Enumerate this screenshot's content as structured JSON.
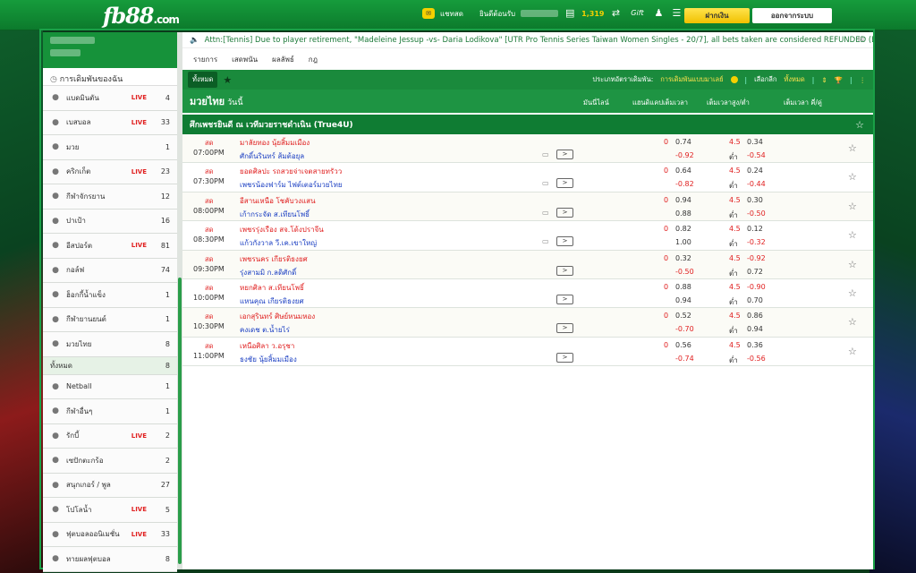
{
  "header": {
    "logo": "fb88",
    "logo_suffix": ".com",
    "chat_label": "แชทสด",
    "welcome": "ยินดีต้อนรับ",
    "credit": "1,319",
    "deposit_label": "ฝากเงิน",
    "logout_label": "ออกจากระบบ",
    "icons": [
      "chat-icon",
      "wallet-icon",
      "refresh-icon",
      "promo-icon",
      "user-icon",
      "list-icon",
      "settings-icon"
    ]
  },
  "ticker": {
    "text": "Attn:[Tennis] Due to player retirement, \"Madeleine Jessup -vs- Daria Lodikova\" [UTR Pro Tennis Series Taiwan Women Singles - 20/7], all bets taken are considered REFUNDED (Except"
  },
  "tabs": [
    "รายการ",
    "เสดพนัน",
    "ผลลัพธ์",
    "กฎ"
  ],
  "sidebar": {
    "header": "การเดิมพันของฉัน",
    "items": [
      {
        "label": "แบดมินตัน",
        "live": "LIVE",
        "count": "4",
        "icon": "badminton-icon"
      },
      {
        "label": "เบสบอล",
        "live": "LIVE",
        "count": "33",
        "icon": "baseball-icon"
      },
      {
        "label": "มวย",
        "live": "",
        "count": "1",
        "icon": "boxing-icon"
      },
      {
        "label": "คริกเก็ต",
        "live": "LIVE",
        "count": "23",
        "icon": "cricket-icon"
      },
      {
        "label": "กีฬาจักรยาน",
        "live": "",
        "count": "12",
        "icon": "cycling-icon"
      },
      {
        "label": "ปาเป้า",
        "live": "",
        "count": "16",
        "icon": "darts-icon"
      },
      {
        "label": "อีสปอร์ต",
        "live": "LIVE",
        "count": "81",
        "icon": "esports-icon"
      },
      {
        "label": "กอล์ฟ",
        "live": "",
        "count": "74",
        "icon": "golf-icon"
      },
      {
        "label": "ฮ็อกกี้น้ำแข็ง",
        "live": "",
        "count": "1",
        "icon": "hockey-icon"
      },
      {
        "label": "กีฬายานยนต์",
        "live": "",
        "count": "1",
        "icon": "motorsport-icon"
      },
      {
        "label": "มวยไทย",
        "live": "",
        "count": "8",
        "icon": "muaythai-icon"
      }
    ],
    "sub_item": {
      "label": "ทั้งหมด",
      "count": "8"
    },
    "items2": [
      {
        "label": "Netball",
        "live": "",
        "count": "1",
        "icon": "netball-icon"
      },
      {
        "label": "กีฬาอื่นๆ",
        "live": "",
        "count": "1",
        "icon": "other-sports-icon"
      },
      {
        "label": "รักบี้",
        "live": "LIVE",
        "count": "2",
        "icon": "rugby-icon"
      },
      {
        "label": "เซปักตะกร้อ",
        "live": "",
        "count": "2",
        "icon": "sepaktakraw-icon"
      },
      {
        "label": "สนุกเกอร์ / พูล",
        "live": "",
        "count": "27",
        "icon": "snooker-icon"
      },
      {
        "label": "โปโลน้ำ",
        "live": "LIVE",
        "count": "5",
        "icon": "waterpolo-icon"
      },
      {
        "label": "ฟุตบอลออนิเมชั่น",
        "live": "LIVE",
        "count": "33",
        "icon": "virtual-football-icon"
      },
      {
        "label": "ทายผลฟุตบอล",
        "live": "",
        "count": "8",
        "icon": "football-predict-icon"
      }
    ]
  },
  "filter": {
    "all_label": "ทั้งหมด",
    "bet_type_label": "ประเภทอัตราเดิมพัน:",
    "bet_type_value": "การเดิมพันแบบมาเลย์",
    "select_label": "เลือกลีก",
    "select_value": "ทั้งหมด"
  },
  "columns": {
    "sport": "มวยไทย",
    "today": "วันนี้",
    "c1": "มันนี่ไลน์",
    "c2": "แฮนดิแคปเต็มเวลา",
    "c3": "เต็มเวลาสูง/ต่ำ",
    "c4": "เต็มเวลา คี่/คู่"
  },
  "league": "ศึกเพชรยินดี ณ เวทีมวยราชดำเนิน (True4U)",
  "matches": [
    {
      "status": "สด",
      "time": "07:00PM",
      "home": "มาลัยทอง นุ้ยสิ้มมเมือง",
      "away": "ศักดิ์นรินทร์ ส้มต้อยุล",
      "hdp": "0",
      "ho": "0.74",
      "ao": "-0.92",
      "ou": "4.5",
      "oo": "0.34",
      "ul": "ต่ำ",
      "uo": "-0.54",
      "chat": true
    },
    {
      "status": "สด",
      "time": "07:30PM",
      "home": "ยอดศิลปะ รถสวยจ่าเจตสายทรัวว",
      "away": "เพชรน้องฟาร์ม ไฟต์เตอร์มวยไทย",
      "hdp": "0",
      "ho": "0.64",
      "ao": "-0.82",
      "ou": "4.5",
      "oo": "0.24",
      "ul": "ต่ำ",
      "uo": "-0.44",
      "chat": true
    },
    {
      "status": "สด",
      "time": "08:00PM",
      "home": "อีสานเหนือ โชคับวงแสน",
      "away": "เก้ากระจัด ส.เทียนโพธิ์",
      "hdp": "0",
      "ho": "0.94",
      "ao": "0.88",
      "ou": "4.5",
      "oo": "0.30",
      "ul": "ต่ำ",
      "uo": "-0.50",
      "chat": true
    },
    {
      "status": "สด",
      "time": "08:30PM",
      "home": "เพชรรุ่งเรือง สจ.โด้งปราจีน",
      "away": "แก้วกังวาล วี.เค.เขาใหญ่",
      "hdp": "0",
      "ho": "0.82",
      "ao": "1.00",
      "ou": "4.5",
      "oo": "0.12",
      "ul": "ต่ำ",
      "uo": "-0.32",
      "chat": true
    },
    {
      "status": "สด",
      "time": "09:30PM",
      "home": "เพชรนคร เกียรติธงยศ",
      "away": "รุ่งสามมิ ก.ลดิศักดิ์",
      "hdp": "0",
      "ho": "0.32",
      "ao": "-0.50",
      "ou": "4.5",
      "oo": "-0.92",
      "ul": "ต่ำ",
      "uo": "0.72",
      "chat": false
    },
    {
      "status": "สด",
      "time": "10:00PM",
      "home": "หยกศิลา ส.เทียนโพธิ์",
      "away": "แหนคุณ เกียรติธงยศ",
      "hdp": "0",
      "ho": "0.88",
      "ao": "0.94",
      "ou": "4.5",
      "oo": "-0.90",
      "ul": "ต่ำ",
      "uo": "0.70",
      "chat": false
    },
    {
      "status": "สด",
      "time": "10:30PM",
      "home": "เอกสุรินทร์ ศิษย์หนมหอง",
      "away": "คงเดช ต.น้ำยไร่",
      "hdp": "0",
      "ho": "0.52",
      "ao": "-0.70",
      "ou": "4.5",
      "oo": "0.86",
      "ul": "ต่ำ",
      "uo": "0.94",
      "chat": false
    },
    {
      "status": "สด",
      "time": "11:00PM",
      "home": "เหนือศิลา ว.อรุชา",
      "away": "ธงชัย นุ้ยสิ้มมเมือง",
      "hdp": "0",
      "ho": "0.56",
      "ao": "-0.74",
      "ou": "4.5",
      "oo": "0.36",
      "ul": "ต่ำ",
      "uo": "-0.56",
      "chat": false
    }
  ]
}
